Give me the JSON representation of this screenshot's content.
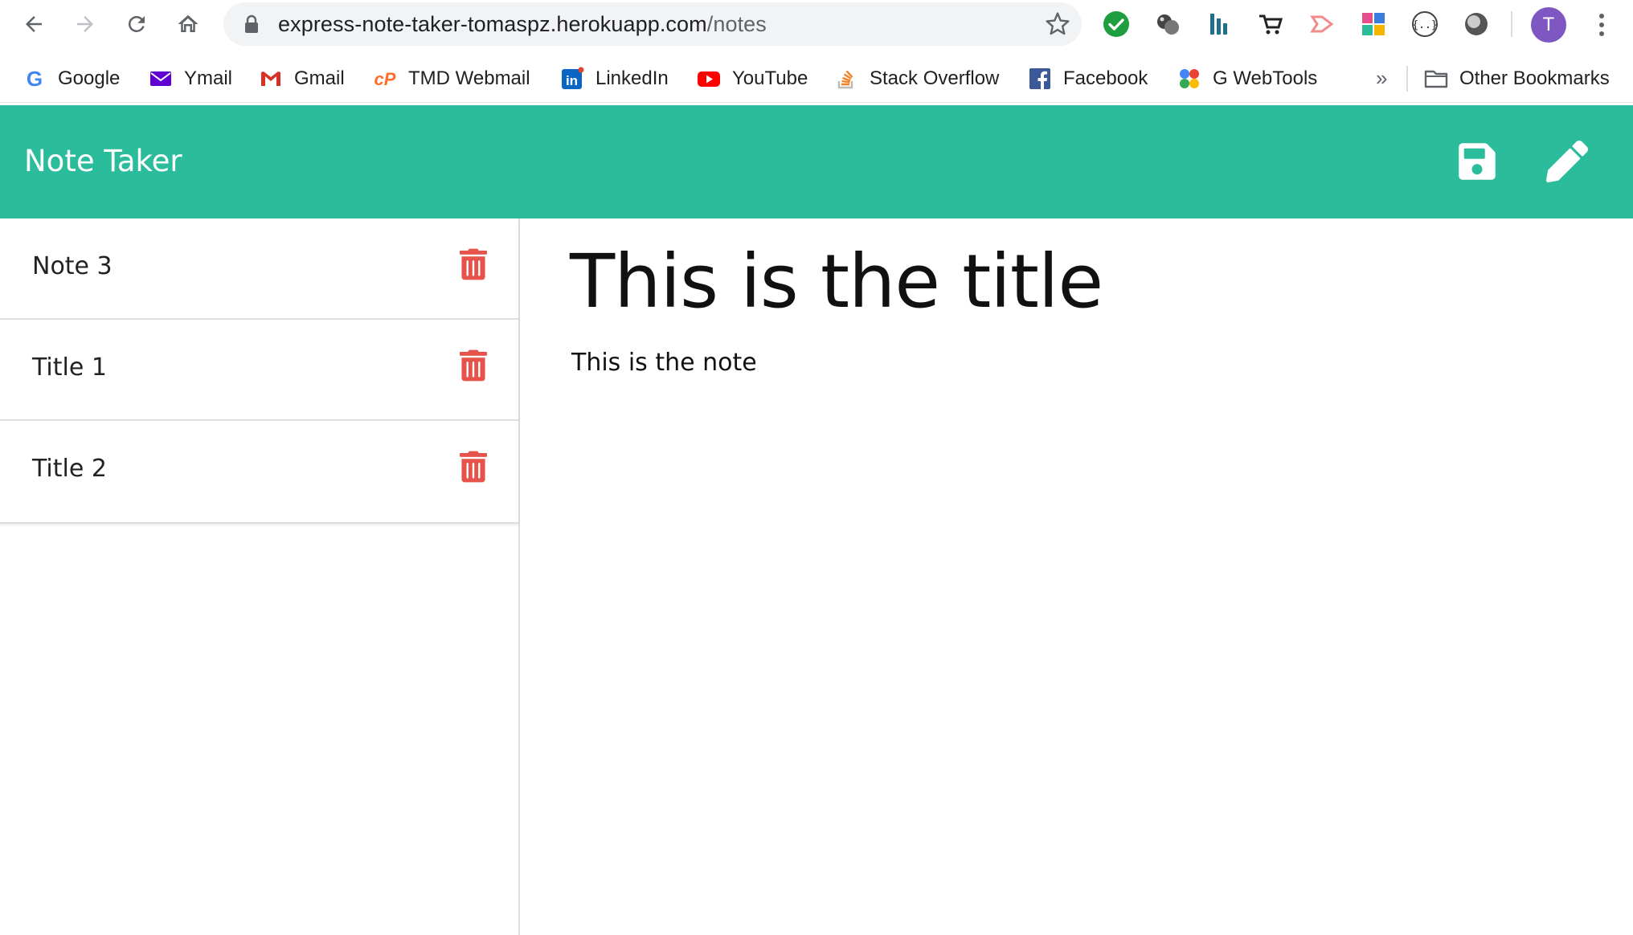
{
  "browser": {
    "url_host": "express-note-taker-tomaspz.herokuapp.com",
    "url_path": "/notes",
    "avatar_letter": "T",
    "bookmarks": [
      {
        "label": "Google",
        "icon": "google-icon"
      },
      {
        "label": "Ymail",
        "icon": "ymail-icon"
      },
      {
        "label": "Gmail",
        "icon": "gmail-icon"
      },
      {
        "label": "TMD Webmail",
        "icon": "cpanel-icon"
      },
      {
        "label": "LinkedIn",
        "icon": "linkedin-icon"
      },
      {
        "label": "YouTube",
        "icon": "youtube-icon"
      },
      {
        "label": "Stack Overflow",
        "icon": "stackoverflow-icon"
      },
      {
        "label": "Facebook",
        "icon": "facebook-icon"
      },
      {
        "label": "G WebTools",
        "icon": "webtools-icon"
      }
    ],
    "overflow_label": "»",
    "other_bookmarks": "Other Bookmarks"
  },
  "app": {
    "brand": "Note Taker",
    "accent_color": "#2bbd9b",
    "trash_color": "#e5534b",
    "notes": [
      {
        "title": "Note 3"
      },
      {
        "title": "Title 1"
      },
      {
        "title": "Title 2"
      }
    ],
    "active_note": {
      "title": "This is the title",
      "text": "This is the note"
    }
  }
}
